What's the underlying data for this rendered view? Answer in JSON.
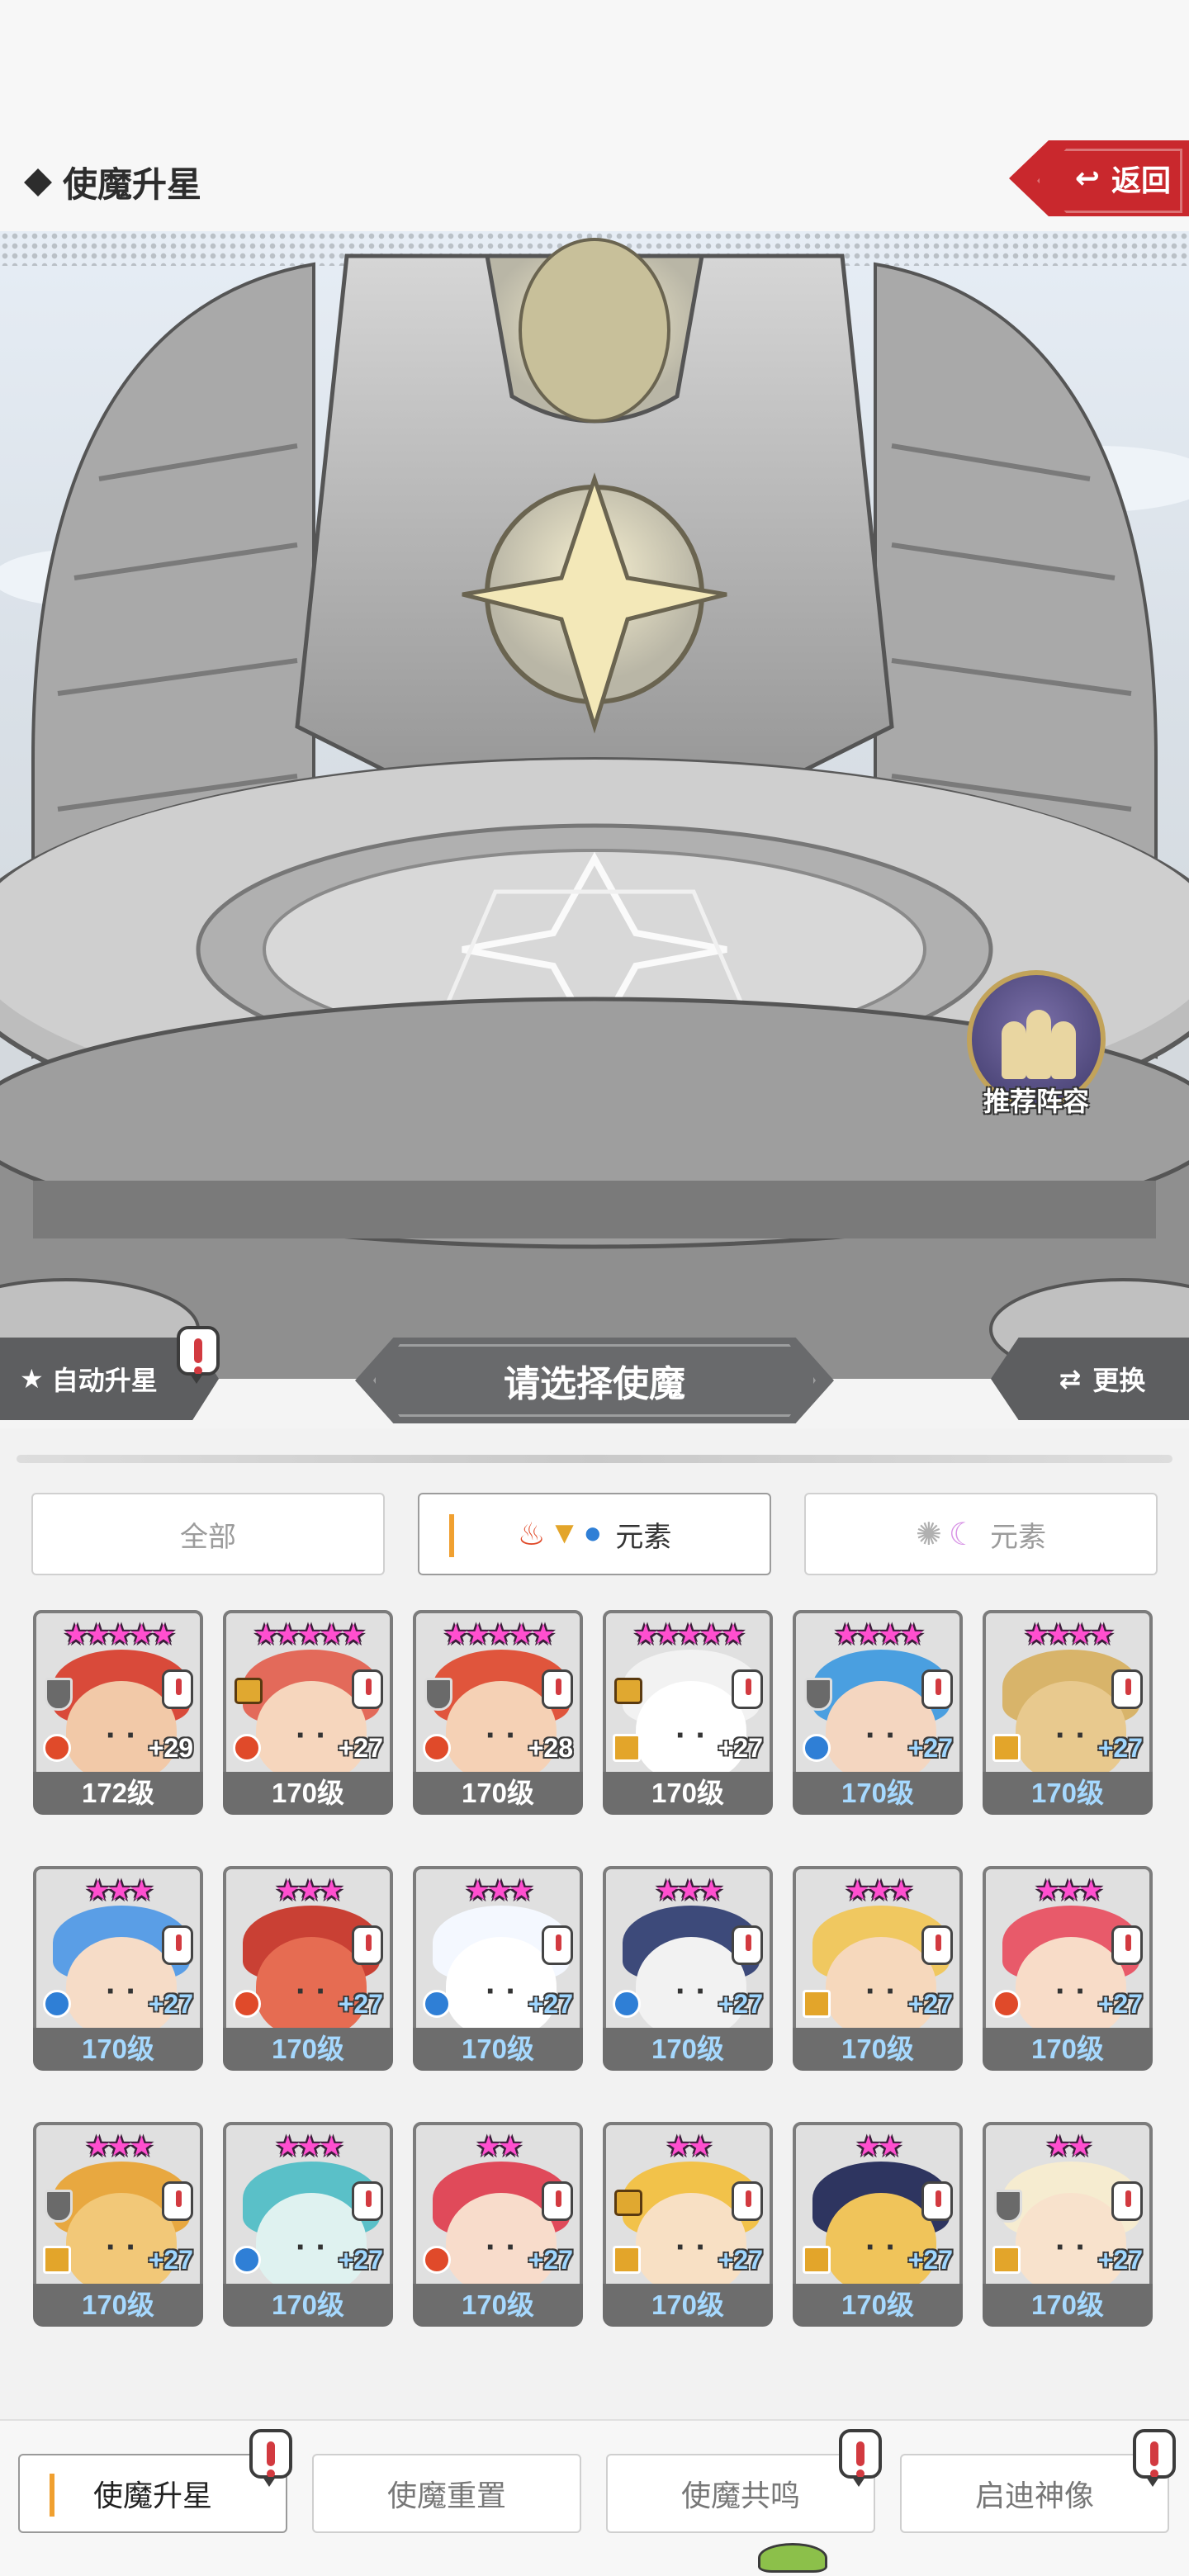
{
  "header": {
    "title": "使魔升星",
    "back_label": "返回"
  },
  "stage": {
    "recommend_label": "推荐阵容"
  },
  "select_bar": {
    "auto_label": "自动升星",
    "title": "请选择使魔",
    "swap_label": "更换"
  },
  "filters": [
    {
      "label": "全部",
      "active": false
    },
    {
      "label": "元素",
      "active": true,
      "icons": [
        "fire-icon",
        "wind-icon",
        "water-icon"
      ]
    },
    {
      "label": "元素",
      "active": false,
      "icons": [
        "light-icon",
        "dark-icon"
      ]
    }
  ],
  "colors": {
    "accent": "#f0a030",
    "back_red": "#c9282d",
    "star_pink": "#ff4fcf",
    "alert_red": "#d23a40"
  },
  "cards": [
    {
      "stars": "★★★★★",
      "plus": "+29",
      "level": "172级",
      "element": "fire",
      "badge": "shield",
      "level_color": "white",
      "hair": "#d94a3a",
      "skin": "#f2c9a8"
    },
    {
      "stars": "★★★★★",
      "plus": "+27",
      "level": "170级",
      "element": "fire",
      "badge": "lock",
      "level_color": "white",
      "hair": "#e36a5a",
      "skin": "#f6d6bd"
    },
    {
      "stars": "★★★★★",
      "plus": "+28",
      "level": "170级",
      "element": "fire",
      "badge": "shield",
      "level_color": "white",
      "hair": "#e0553c",
      "skin": "#f5d1b5"
    },
    {
      "stars": "★★★★★",
      "plus": "+27",
      "level": "170级",
      "element": "wind",
      "badge": "lock",
      "level_color": "white",
      "hair": "#f2f2f2",
      "skin": "#ffffff"
    },
    {
      "stars": "★★★★",
      "plus": "+27",
      "level": "170级",
      "element": "water",
      "badge": "shield",
      "level_color": "blue",
      "hair": "#4a9fe0",
      "skin": "#f4d6c0"
    },
    {
      "stars": "★★★★",
      "plus": "+27",
      "level": "170级",
      "element": "wind",
      "badge": "none",
      "level_color": "blue",
      "hair": "#d8b46a",
      "skin": "#e8c98e"
    },
    {
      "stars": "★★★",
      "plus": "+27",
      "level": "170级",
      "element": "water",
      "badge": "none",
      "level_color": "blue",
      "hair": "#5a9ee6",
      "skin": "#f6dcc7"
    },
    {
      "stars": "★★★",
      "plus": "+27",
      "level": "170级",
      "element": "fire",
      "badge": "none",
      "level_color": "blue",
      "hair": "#c94034",
      "skin": "#e66c52"
    },
    {
      "stars": "★★★",
      "plus": "+27",
      "level": "170级",
      "element": "water",
      "badge": "none",
      "level_color": "blue",
      "hair": "#f4f8ff",
      "skin": "#ffffff"
    },
    {
      "stars": "★★★",
      "plus": "+27",
      "level": "170级",
      "element": "water",
      "badge": "none",
      "level_color": "blue",
      "hair": "#3d4a7a",
      "skin": "#f2f2f2"
    },
    {
      "stars": "★★★",
      "plus": "+27",
      "level": "170级",
      "element": "wind",
      "badge": "none",
      "level_color": "blue",
      "hair": "#f0c860",
      "skin": "#f6d8bc"
    },
    {
      "stars": "★★★",
      "plus": "+27",
      "level": "170级",
      "element": "fire",
      "badge": "none",
      "level_color": "blue",
      "hair": "#e85a6a",
      "skin": "#f8dcc8"
    },
    {
      "stars": "★★★",
      "plus": "+27",
      "level": "170级",
      "element": "wind",
      "badge": "shield",
      "level_color": "blue",
      "hair": "#e8a840",
      "skin": "#f2c878"
    },
    {
      "stars": "★★★",
      "plus": "+27",
      "level": "170级",
      "element": "water",
      "badge": "none",
      "level_color": "blue",
      "hair": "#5ac0c8",
      "skin": "#dff2f0"
    },
    {
      "stars": "★★",
      "plus": "+27",
      "level": "170级",
      "element": "fire",
      "badge": "none",
      "level_color": "blue",
      "hair": "#e04a5a",
      "skin": "#f8dccb"
    },
    {
      "stars": "★★",
      "plus": "+27",
      "level": "170级",
      "element": "wind",
      "badge": "lock",
      "level_color": "blue",
      "hair": "#f2c24a",
      "skin": "#f8e0c4"
    },
    {
      "stars": "★★",
      "plus": "+27",
      "level": "170级",
      "element": "wind",
      "badge": "none",
      "level_color": "blue",
      "hair": "#2e3560",
      "skin": "#f0c45a"
    },
    {
      "stars": "★★",
      "plus": "+27",
      "level": "170级",
      "element": "wind",
      "badge": "shield",
      "level_color": "blue",
      "hair": "#f6ecd0",
      "skin": "#f8e2cc"
    }
  ],
  "tabs": [
    {
      "label": "使魔升星",
      "active": true
    },
    {
      "label": "使魔重置",
      "active": false
    },
    {
      "label": "使魔共鸣",
      "active": false
    },
    {
      "label": "启迪神像",
      "active": false
    }
  ]
}
